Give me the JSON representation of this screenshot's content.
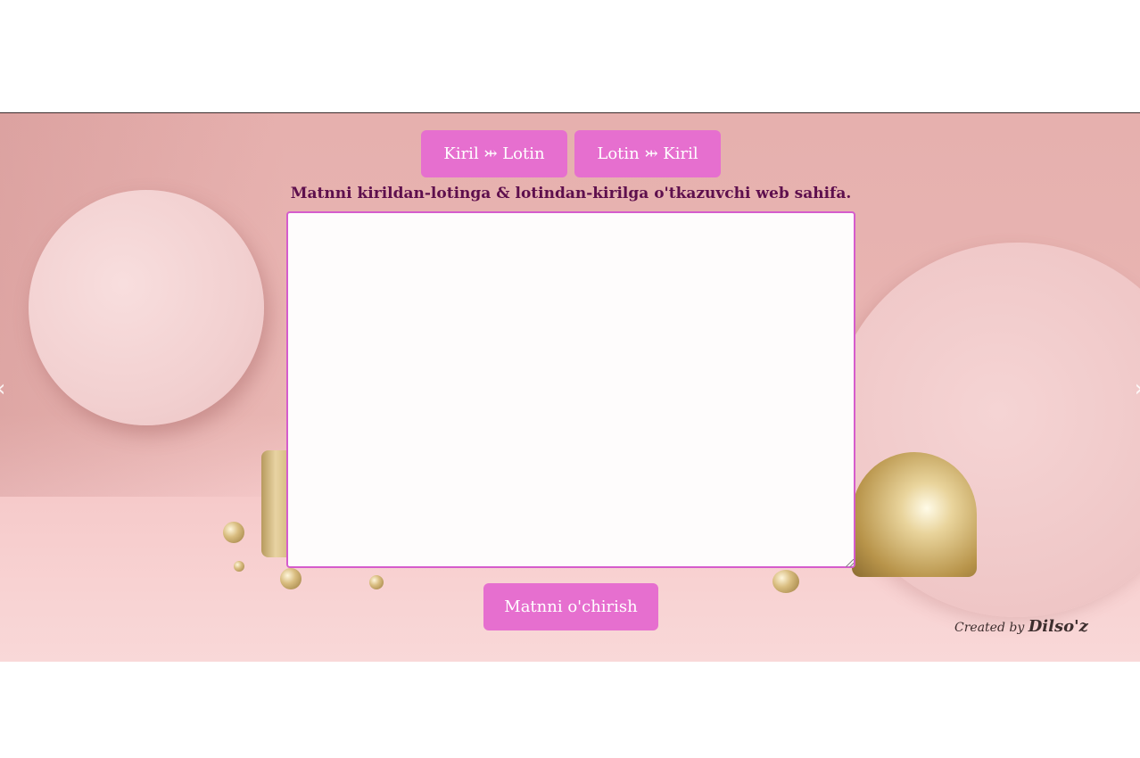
{
  "buttons": {
    "kiril_lotin": "Kiril ⤔ Lotin",
    "lotin_kiril": "Lotin ⤔ Kiril",
    "clear": "Matnni o'chirish"
  },
  "heading": "Matnni kirildan-lotinga & lotindan-kirilga o'tkazuvchi web sahifa.",
  "textarea": {
    "value": "",
    "placeholder": ""
  },
  "credit": {
    "prefix": "Created by ",
    "name": "Dilso'z"
  },
  "carousel": {
    "prev": "‹",
    "next": "›"
  },
  "colors": {
    "button_bg": "#e66fcf",
    "heading": "#5e0f4d",
    "textarea_border": "#d55ccc"
  }
}
